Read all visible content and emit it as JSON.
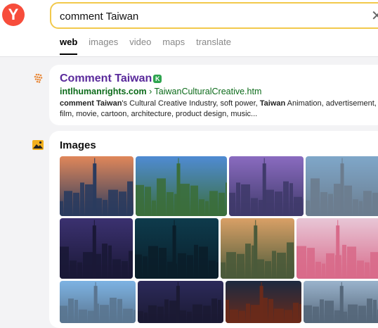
{
  "header": {
    "logo_letter": "Y",
    "search_value": "comment Taiwan",
    "clear_symbol": "✕",
    "tabs": [
      {
        "label": "web",
        "active": true
      },
      {
        "label": "images",
        "active": false
      },
      {
        "label": "video",
        "active": false
      },
      {
        "label": "maps",
        "active": false
      },
      {
        "label": "translate",
        "active": false
      }
    ]
  },
  "result": {
    "title": "Comment Taiwan",
    "badge": "K",
    "url_domain": "intlhumanrights.com",
    "url_separator": "›",
    "url_path": "TaiwanCulturalCreative.htm",
    "snippet_1_bold": "comment Taiwan",
    "snippet_2": "'s Cultural Creative Industry, soft power, ",
    "snippet_3_bold": "Taiwan",
    "snippet_4": " Animation, advertisement, film, movie, cartoon, architecture, product design, music..."
  },
  "images": {
    "title": "Images",
    "thumbnails": [
      {
        "name": "taipei-101-sunset",
        "sky": "#e0875a",
        "ground": "#2a3b5e"
      },
      {
        "name": "taipei-skyline-day",
        "sky": "#4f8bd3",
        "ground": "#3b6e3b"
      },
      {
        "name": "taipei-purple-dusk",
        "sky": "#8a6bc0",
        "ground": "#3f3a6a"
      },
      {
        "name": "taipei-city-flag",
        "sky": "#7fa7c9",
        "ground": "#6b7c8e"
      },
      {
        "name": "taipei-101-night",
        "sky": "#3b3170",
        "ground": "#1a1836"
      },
      {
        "name": "taipei-night-teal",
        "sky": "#0e3b4c",
        "ground": "#0a1e2a"
      },
      {
        "name": "taipei-hill-view",
        "sky": "#d9a066",
        "ground": "#4a5a3a"
      },
      {
        "name": "cherry-blossom-pagoda",
        "sky": "#e8c6d6",
        "ground": "#d86a8a"
      },
      {
        "name": "taipei-101-blue",
        "sky": "#7db3e3",
        "ground": "#5a7590"
      },
      {
        "name": "taipei-101-evening",
        "sky": "#2c2a5a",
        "ground": "#1b1a33"
      },
      {
        "name": "temple-night",
        "sky": "#1d2a40",
        "ground": "#6a2a1a"
      },
      {
        "name": "flag-skyline",
        "sky": "#9ab3cc",
        "ground": "#55677a"
      },
      {
        "name": "taipei-101-clear",
        "sky": "#3b82d0",
        "ground": "#3a5a7a"
      }
    ]
  }
}
